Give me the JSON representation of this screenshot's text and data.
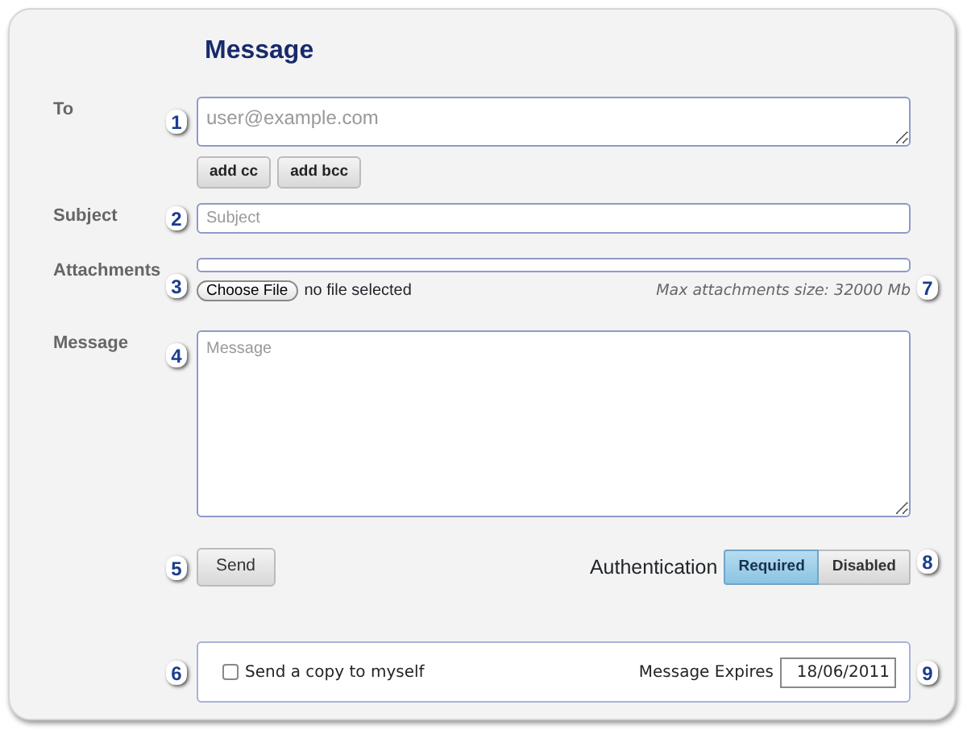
{
  "title": "Message",
  "to": {
    "label": "To",
    "marker": "1",
    "placeholder": "user@example.com"
  },
  "recipient_buttons": [
    "add cc",
    "add bcc"
  ],
  "subject": {
    "label": "Subject",
    "marker": "2",
    "placeholder": "Subject"
  },
  "attachments": {
    "label": "Attachments",
    "marker": "3",
    "button": "Choose File",
    "status": "no file selected",
    "limit": "Max attachments size: 32000 Mb",
    "limit_marker": "7"
  },
  "message": {
    "label": "Message",
    "marker": "4",
    "placeholder": "Message"
  },
  "send": {
    "marker": "5",
    "label": "Send"
  },
  "authentication": {
    "label": "Authentication",
    "marker": "8",
    "options": [
      {
        "label": "Required",
        "selected": true
      },
      {
        "label": "Disabled",
        "selected": false
      }
    ]
  },
  "options_box": {
    "marker": "6",
    "copy": {
      "label": "Send a copy to myself",
      "checked": false
    },
    "expires": {
      "label": "Message Expires",
      "value": "18/06/2011"
    },
    "expires_marker": "9"
  }
}
